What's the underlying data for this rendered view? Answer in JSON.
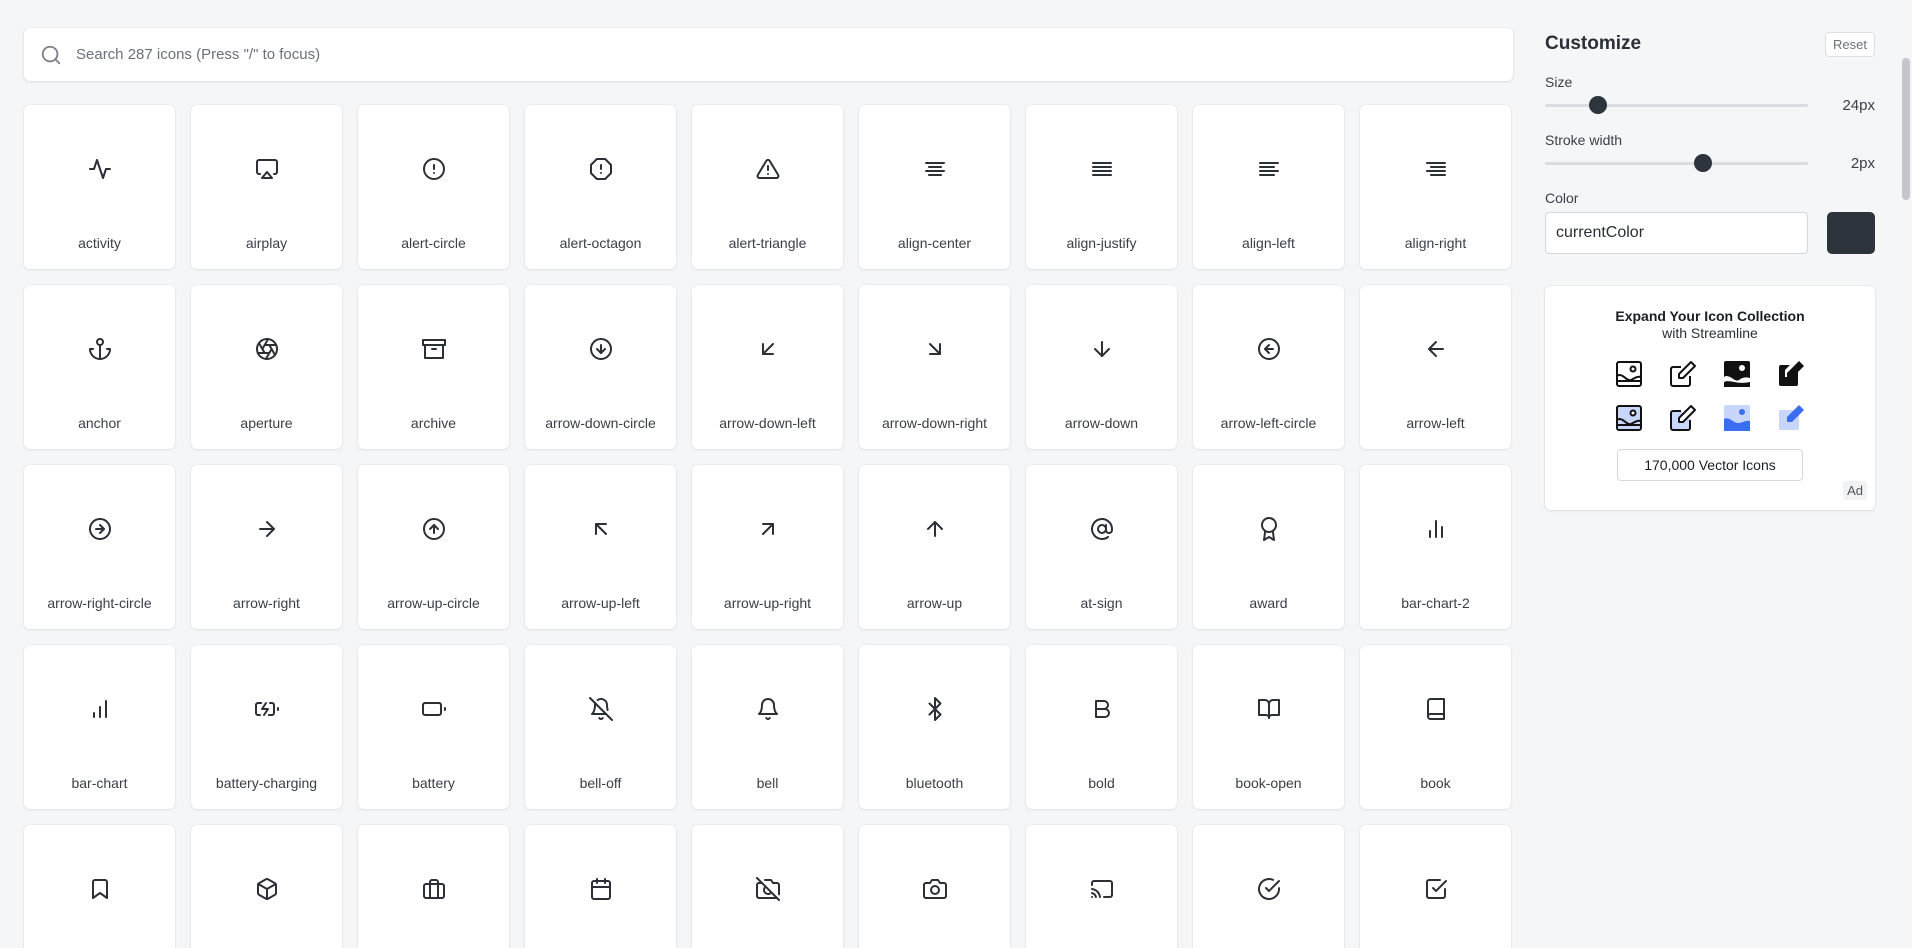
{
  "search": {
    "placeholder": "Search 287 icons (Press \"/\" to focus)"
  },
  "icons": [
    {
      "name": "activity",
      "icon": "activity-icon"
    },
    {
      "name": "airplay",
      "icon": "airplay-icon"
    },
    {
      "name": "alert-circle",
      "icon": "alert-circle-icon"
    },
    {
      "name": "alert-octagon",
      "icon": "alert-octagon-icon"
    },
    {
      "name": "alert-triangle",
      "icon": "alert-triangle-icon"
    },
    {
      "name": "align-center",
      "icon": "align-center-icon"
    },
    {
      "name": "align-justify",
      "icon": "align-justify-icon"
    },
    {
      "name": "align-left",
      "icon": "align-left-icon"
    },
    {
      "name": "align-right",
      "icon": "align-right-icon"
    },
    {
      "name": "anchor",
      "icon": "anchor-icon"
    },
    {
      "name": "aperture",
      "icon": "aperture-icon"
    },
    {
      "name": "archive",
      "icon": "archive-icon"
    },
    {
      "name": "arrow-down-circle",
      "icon": "arrow-down-circle-icon"
    },
    {
      "name": "arrow-down-left",
      "icon": "arrow-down-left-icon"
    },
    {
      "name": "arrow-down-right",
      "icon": "arrow-down-right-icon"
    },
    {
      "name": "arrow-down",
      "icon": "arrow-down-icon"
    },
    {
      "name": "arrow-left-circle",
      "icon": "arrow-left-circle-icon"
    },
    {
      "name": "arrow-left",
      "icon": "arrow-left-icon"
    },
    {
      "name": "arrow-right-circle",
      "icon": "arrow-right-circle-icon"
    },
    {
      "name": "arrow-right",
      "icon": "arrow-right-icon"
    },
    {
      "name": "arrow-up-circle",
      "icon": "arrow-up-circle-icon"
    },
    {
      "name": "arrow-up-left",
      "icon": "arrow-up-left-icon"
    },
    {
      "name": "arrow-up-right",
      "icon": "arrow-up-right-icon"
    },
    {
      "name": "arrow-up",
      "icon": "arrow-up-icon"
    },
    {
      "name": "at-sign",
      "icon": "at-sign-icon"
    },
    {
      "name": "award",
      "icon": "award-icon"
    },
    {
      "name": "bar-chart-2",
      "icon": "bar-chart-2-icon"
    },
    {
      "name": "bar-chart",
      "icon": "bar-chart-icon"
    },
    {
      "name": "battery-charging",
      "icon": "battery-charging-icon"
    },
    {
      "name": "battery",
      "icon": "battery-icon"
    },
    {
      "name": "bell-off",
      "icon": "bell-off-icon"
    },
    {
      "name": "bell",
      "icon": "bell-icon"
    },
    {
      "name": "bluetooth",
      "icon": "bluetooth-icon"
    },
    {
      "name": "bold",
      "icon": "bold-icon"
    },
    {
      "name": "book-open",
      "icon": "book-open-icon"
    },
    {
      "name": "book",
      "icon": "book-icon"
    },
    {
      "name": "",
      "icon": "bookmark-icon"
    },
    {
      "name": "",
      "icon": "box-icon"
    },
    {
      "name": "",
      "icon": "briefcase-icon"
    },
    {
      "name": "",
      "icon": "calendar-icon"
    },
    {
      "name": "",
      "icon": "camera-off-icon"
    },
    {
      "name": "",
      "icon": "camera-icon"
    },
    {
      "name": "",
      "icon": "cast-icon"
    },
    {
      "name": "",
      "icon": "check-circle-icon"
    },
    {
      "name": "",
      "icon": "check-square-icon"
    }
  ],
  "customize": {
    "title": "Customize",
    "reset_label": "Reset",
    "size": {
      "label": "Size",
      "value": 24,
      "min": 12,
      "max": 72,
      "display": "24px"
    },
    "stroke": {
      "label": "Stroke width",
      "value": 2,
      "min": 0.5,
      "max": 3,
      "display": "2px"
    },
    "color": {
      "label": "Color",
      "value": "currentColor",
      "swatch": "#2e343c"
    }
  },
  "ad": {
    "title": "Expand Your Icon Collection",
    "subtitle": "with Streamline",
    "button_label": "170,000 Vector Icons",
    "tag": "Ad",
    "icons": [
      "image-outline-icon",
      "edit-outline-icon",
      "image-solid-icon",
      "edit-solid-icon",
      "image-duo-icon",
      "edit-duo-icon",
      "image-flat-blue-icon",
      "edit-flat-blue-icon"
    ],
    "accent": "#3b6df0"
  }
}
